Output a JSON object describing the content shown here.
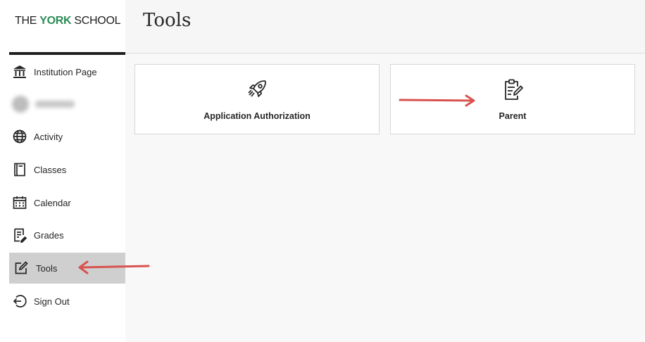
{
  "sidebar": {
    "logo": {
      "prefix": "THE ",
      "accent": "YORK",
      "suffix": " SCHOOL"
    },
    "items": [
      {
        "label": "Institution Page",
        "icon": "institution-icon"
      },
      {
        "label": "",
        "icon": "avatar"
      },
      {
        "label": "Activity",
        "icon": "globe-icon"
      },
      {
        "label": "Classes",
        "icon": "book-icon"
      },
      {
        "label": "Calendar",
        "icon": "calendar-icon"
      },
      {
        "label": "Grades",
        "icon": "grades-icon"
      },
      {
        "label": "Tools",
        "icon": "edit-box-icon",
        "active": true
      },
      {
        "label": "Sign Out",
        "icon": "sign-out-icon"
      }
    ]
  },
  "main": {
    "title": "Tools",
    "tiles": [
      {
        "label": "Application Authorization",
        "icon": "rocket-icon"
      },
      {
        "label": "Parent",
        "icon": "clipboard-edit-icon"
      }
    ]
  },
  "colors": {
    "accent": "#2e8b57",
    "active_bg": "#cfcfcf",
    "annotation_arrow": "#d9534f"
  }
}
